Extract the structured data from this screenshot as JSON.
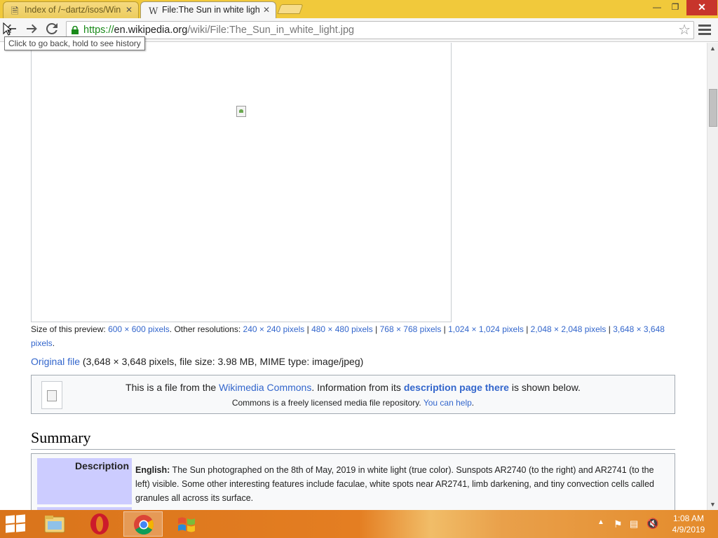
{
  "browser": {
    "tabs": [
      {
        "title": "Index of /~dartz/isos/Win",
        "active": false
      },
      {
        "title": "File:The Sun in white light",
        "active": true
      }
    ],
    "url": {
      "scheme": "https://",
      "host": "en.wikipedia.org",
      "path": "/wiki/File:The_Sun_in_white_light.jpg"
    },
    "tooltip": "Click to go back, hold to see history",
    "window_controls": {
      "minimize": "—",
      "maximize": "❐",
      "close": "✕"
    }
  },
  "page": {
    "preview_label": "Size of this preview:",
    "preview_size": "600 × 600 pixels",
    "other_label": ". Other resolutions:",
    "resolutions": [
      "240 × 240 pixels",
      "480 × 480 pixels",
      "768 × 768 pixels",
      "1,024 × 1,024 pixels",
      "2,048 × 2,048 pixels",
      "3,648 × 3,648 pixels"
    ],
    "resolution_separator": " | ",
    "sizes_end": ".",
    "original_file_link": "Original file",
    "original_file_info": " (3,648 × 3,648 pixels, file size: 3.98 MB, MIME type: image/jpeg)",
    "commons": {
      "text1": "This is a file from the ",
      "link1": "Wikimedia Commons",
      "text2": ". Information from its ",
      "link2": "description page there",
      "text3": " is shown below.",
      "line2_text": "Commons is a freely licensed media file repository. ",
      "line2_link": "You can help",
      "line2_end": "."
    },
    "summary_heading": "Summary",
    "description": {
      "label": "Description",
      "lang": "English:",
      "text": " The Sun photographed on the 8th of May, 2019 in white light (true color). Sunspots AR2740 (to the right) and AR2741 (to the left) visible. Some other interesting features include faculae, white spots near AR2741, limb darkening, and tiny convection cells called granules all across its surface."
    }
  },
  "taskbar": {
    "clock_time": "1:08 AM",
    "clock_date": "4/9/2019",
    "apps": [
      "file-explorer",
      "opera",
      "chrome",
      "windows"
    ]
  },
  "colors": {
    "link": "#3366cc",
    "titlebar": "#f1c93b",
    "taskbar": "#e47e22",
    "description_label_bg": "#ccccff"
  }
}
